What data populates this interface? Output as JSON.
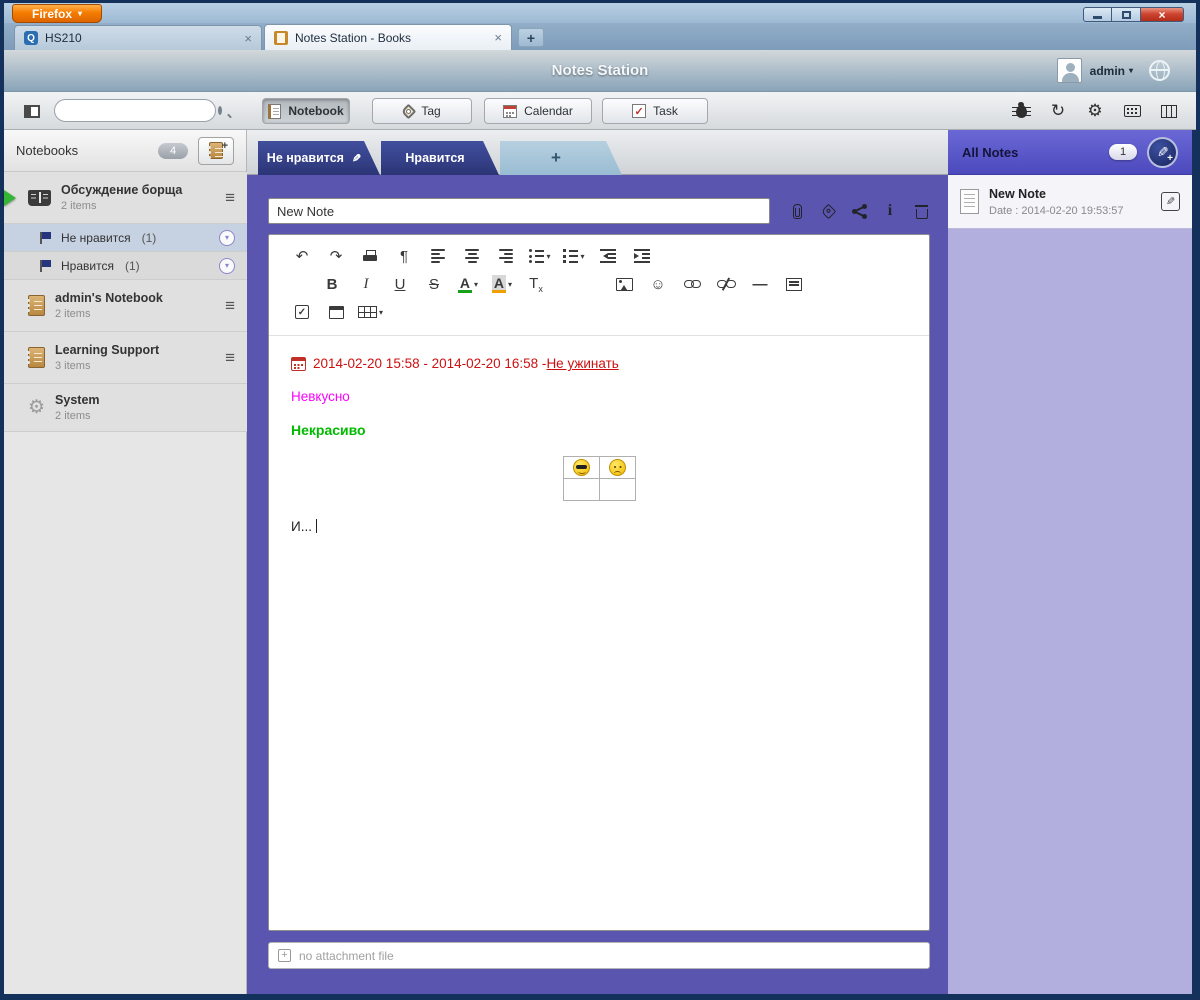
{
  "glyphs": {
    "caret_down": "▾",
    "close": "×",
    "plus": "+",
    "menu": "≡",
    "undo": "↶",
    "redo": "↷",
    "pilcrow": "¶",
    "bold": "B",
    "italic": "I",
    "underline": "U",
    "strike": "S",
    "font_a": "A",
    "clear_t": "T",
    "clear_x": "x",
    "smiley": "☺",
    "hr": "—",
    "check": "✓",
    "pencil": "✎",
    "refresh": "↻",
    "gear": "⚙",
    "info": "i",
    "q_logo": "Q"
  },
  "window": {
    "firefox_label": "Firefox",
    "tabs": [
      {
        "label": "HS210"
      },
      {
        "label": "Notes Station - Books"
      }
    ]
  },
  "header": {
    "title": "Notes Station",
    "user": "admin"
  },
  "toolbar": {
    "nav": [
      {
        "label": "Notebook"
      },
      {
        "label": "Tag"
      },
      {
        "label": "Calendar"
      },
      {
        "label": "Task"
      }
    ]
  },
  "sidebar": {
    "title": "Notebooks",
    "count": "4",
    "items": [
      {
        "name": "Обсуждение борща",
        "meta": "2 items"
      },
      {
        "name": "Не нравится",
        "count": "(1)"
      },
      {
        "name": "Нравится",
        "count": "(1)"
      },
      {
        "name": "admin's Notebook",
        "meta": "2 items"
      },
      {
        "name": "Learning Support",
        "meta": "3 items"
      },
      {
        "name": "System",
        "meta": "2 items"
      }
    ]
  },
  "main": {
    "tabs": [
      {
        "label": "Не нравится"
      },
      {
        "label": "Нравится"
      }
    ],
    "note_title": "New Note",
    "attachment_placeholder": "no attachment file"
  },
  "editor": {
    "event_text": "2014-02-20 15:58 - 2014-02-20 16:58 - ",
    "event_link": "Не ужинать",
    "line_magenta": "Невкусно",
    "line_green": "Некрасиво",
    "line_end": "И... "
  },
  "right": {
    "title": "All Notes",
    "count": "1",
    "notes": [
      {
        "title": "New Note",
        "date": "Date : 2014-02-20 19:53:57"
      }
    ]
  },
  "colors": {
    "main_purple": "#5a55ae",
    "right_lavender": "#b2aede",
    "tab_navy": "#2f3a80",
    "event_red": "#cc1111",
    "magenta": "#ff00ff",
    "green": "#00bb00",
    "firefox_orange": "#f57d00"
  }
}
